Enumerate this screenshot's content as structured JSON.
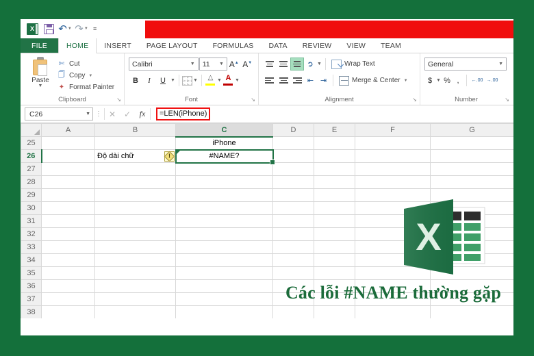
{
  "app": {
    "name": "Microsoft Excel",
    "title_redacted": true,
    "redaction_color": "#f00d0d"
  },
  "quick_access": {
    "items": [
      {
        "name": "excel-app-icon",
        "label": "X"
      },
      {
        "name": "save-icon",
        "label": "Save"
      },
      {
        "name": "undo-icon",
        "label": "↶"
      },
      {
        "name": "redo-icon",
        "label": "↷"
      },
      {
        "name": "customize-qat-icon",
        "label": "≡"
      }
    ]
  },
  "ribbon": {
    "tabs": [
      {
        "label": "FILE",
        "active": false,
        "file": true
      },
      {
        "label": "HOME",
        "active": true
      },
      {
        "label": "INSERT",
        "active": false
      },
      {
        "label": "PAGE LAYOUT",
        "active": false
      },
      {
        "label": "FORMULAS",
        "active": false
      },
      {
        "label": "DATA",
        "active": false
      },
      {
        "label": "REVIEW",
        "active": false
      },
      {
        "label": "VIEW",
        "active": false
      },
      {
        "label": "TEAM",
        "active": false
      }
    ],
    "clipboard": {
      "group_label": "Clipboard",
      "paste_label": "Paste",
      "cut_label": "Cut",
      "copy_label": "Copy",
      "format_painter_label": "Format Painter"
    },
    "font": {
      "group_label": "Font",
      "font_name": "Calibri",
      "font_size": "11",
      "bold_label": "B",
      "italic_label": "I",
      "underline_label": "U",
      "grow_font_label": "A",
      "shrink_font_label": "A",
      "fill_color_label": "△",
      "font_color_label": "A",
      "fill_color": "#ffff00",
      "font_color": "#c00000"
    },
    "alignment": {
      "group_label": "Alignment",
      "wrap_text_label": "Wrap Text",
      "merge_center_label": "Merge & Center",
      "vertical_selected": "middle-align",
      "horizontal_selected": "none"
    },
    "number": {
      "group_label": "Number",
      "format": "General",
      "currency_label": "$",
      "percent_label": "%",
      "comma_label": ",",
      "increase_decimal_label": ".00",
      "decrease_decimal_label": ".00"
    }
  },
  "formula_bar": {
    "name_box": "C26",
    "cancel_label": "✕",
    "enter_label": "✓",
    "function_label": "fx",
    "formula": "=LEN(iPhone)",
    "formula_highlight_color": "#f01212"
  },
  "sheet": {
    "columns": [
      "A",
      "B",
      "C",
      "D",
      "E",
      "F",
      "G"
    ],
    "selected_column": "C",
    "selected_row": "26",
    "rows": [
      {
        "num": "25",
        "cells": {
          "B": "",
          "C": "iPhone"
        }
      },
      {
        "num": "26",
        "cells": {
          "B": "Độ dài chữ",
          "C": "#NAME?"
        },
        "warning": true
      },
      {
        "num": "27",
        "cells": {}
      },
      {
        "num": "28",
        "cells": {}
      },
      {
        "num": "29",
        "cells": {}
      },
      {
        "num": "30",
        "cells": {}
      },
      {
        "num": "31",
        "cells": {}
      },
      {
        "num": "32",
        "cells": {}
      },
      {
        "num": "33",
        "cells": {}
      },
      {
        "num": "34",
        "cells": {}
      },
      {
        "num": "35",
        "cells": {}
      },
      {
        "num": "36",
        "cells": {}
      },
      {
        "num": "37",
        "cells": {}
      },
      {
        "num": "38",
        "cells": {}
      }
    ],
    "active_cell": "C26",
    "active_cell_value": "#NAME?",
    "warning_icon_tooltip": "!"
  },
  "overlay": {
    "caption": "Các lỗi #NAME thường gặp",
    "caption_color": "#1b6b3a",
    "logo_letter": "X",
    "logo_color": "#1d7044"
  },
  "theme": {
    "frame_green": "#14703b",
    "excel_green": "#217346",
    "selection_green": "#217346"
  }
}
